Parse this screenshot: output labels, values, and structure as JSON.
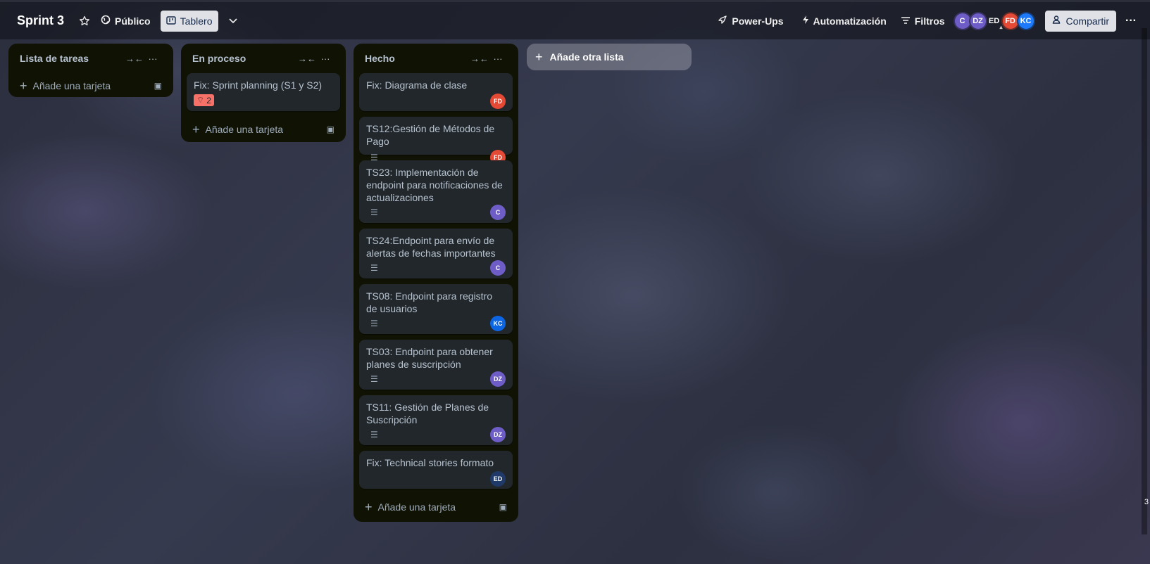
{
  "header": {
    "board_title": "Sprint 3",
    "visibility_label": "Público",
    "view_label": "Tablero",
    "powerups_label": "Power-Ups",
    "automation_label": "Automatización",
    "filters_label": "Filtros",
    "share_label": "Compartir",
    "members": [
      {
        "initials": "C",
        "color": "#6e5dc6"
      },
      {
        "initials": "DZ",
        "color": "#6e5dc6"
      },
      {
        "initials": "ED",
        "color": "transparent"
      },
      {
        "initials": "FD",
        "color": "#e34935"
      },
      {
        "initials": "KC",
        "color": "#1d7afc"
      }
    ]
  },
  "lists": [
    {
      "title": "Lista de tareas",
      "add_card_label": "Añade una tarjeta",
      "cards": []
    },
    {
      "title": "En proceso",
      "add_card_label": "Añade una tarjeta",
      "cards": [
        {
          "title": "Fix: Sprint planning (S1 y S2)",
          "badge": "2"
        }
      ]
    },
    {
      "title": "Hecho",
      "add_card_label": "Añade una tarjeta",
      "cards": [
        {
          "title": "Fix: Diagrama de clase",
          "avatar": "FD"
        },
        {
          "title": "TS12:Gestión de Métodos de Pago",
          "avatar": "FD"
        },
        {
          "title": "TS23: Implementación de endpoint para notificaciones de actualizaciones",
          "avatar": "C"
        },
        {
          "title": "TS24:Endpoint para envío de alertas de fechas importantes",
          "avatar": "C"
        },
        {
          "title": "TS08: Endpoint para registro de usuarios",
          "avatar": "KC"
        },
        {
          "title": "TS03: Endpoint para obtener planes de suscripción",
          "avatar": "DZ"
        },
        {
          "title": "TS11: Gestión de Planes de Suscripción",
          "avatar": "DZ"
        },
        {
          "title": "Fix: Technical stories formato",
          "avatar": "ED"
        }
      ]
    }
  ],
  "add_list_label": "Añade otra lista",
  "edge_number": "3",
  "avatar_colors": {
    "FD": "#e34935",
    "C": "#6e5dc6",
    "KC": "#0c66e4",
    "DZ": "#6e5dc6",
    "ED": "#1f3a68"
  }
}
